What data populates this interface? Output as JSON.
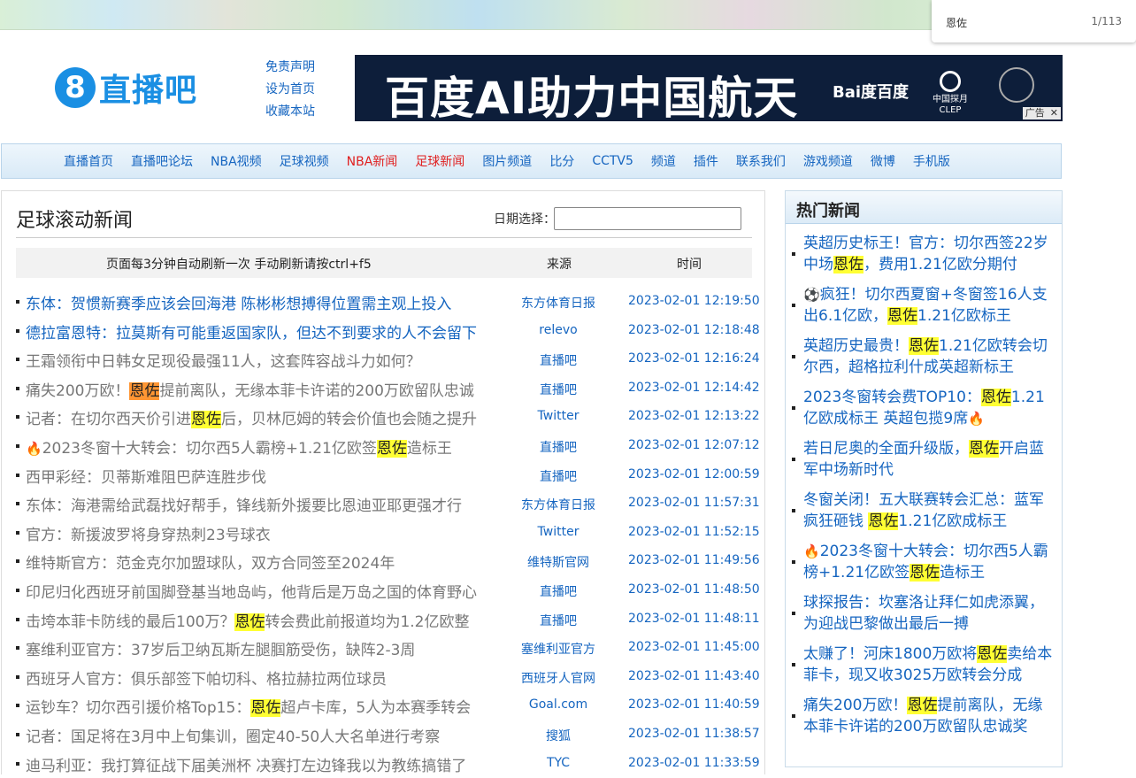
{
  "find": {
    "query": "恩佐",
    "count": "1/113"
  },
  "logo": {
    "number": "8",
    "text": "直播吧"
  },
  "toplinks": [
    "免责声明",
    "设为首页",
    "收藏本站"
  ],
  "banner": {
    "title": "百度AI助力中国航天",
    "brand": "Bai度百度",
    "partner": "中国探月",
    "partner_sub": "CLEP",
    "ad_label": "广告",
    "ad_close": "✕"
  },
  "nav": [
    {
      "label": "直播首页"
    },
    {
      "label": "直播吧论坛"
    },
    {
      "label": "NBA视频"
    },
    {
      "label": "足球视频"
    },
    {
      "label": "NBA新闻",
      "active": true
    },
    {
      "label": "足球新闻",
      "active": true
    },
    {
      "label": "图片频道"
    },
    {
      "label": "比分"
    },
    {
      "label": "CCTV5"
    },
    {
      "label": "频道"
    },
    {
      "label": "插件"
    },
    {
      "label": "联系我们"
    },
    {
      "label": "游戏频道"
    },
    {
      "label": "微博"
    },
    {
      "label": "手机版"
    }
  ],
  "main": {
    "title": "足球滚动新闻",
    "date_label": "日期选择：",
    "date_value": "",
    "headers": {
      "info": "页面每3分钟自动刷新一次 手动刷新请按ctrl+f5",
      "source": "来源",
      "time": "时间"
    },
    "rows": [
      {
        "title": "东体：贺惯新赛季应该会回海港 陈彬彬想搏得位置需主观上投入",
        "source": "东方体育日报",
        "time": "2023-02-01 12:19:50",
        "blue": true
      },
      {
        "title": "德拉富恩特：拉莫斯有可能重返国家队，但达不到要求的人不会留下",
        "source": "relevo",
        "time": "2023-02-01 12:18:48",
        "blue": true
      },
      {
        "title": "王霜领衔中日韩女足现役最强11人，这套阵容战斗力如何？",
        "source": "直播吧",
        "time": "2023-02-01 12:16:24"
      },
      {
        "pre": "痛失200万欧！",
        "hl": "恩佐",
        "hlclass": "hlo",
        "post": "提前离队，无缘本菲卡许诺的200万欧留队忠诚",
        "source": "直播吧",
        "time": "2023-02-01 12:14:42"
      },
      {
        "pre": "记者：在切尔西天价引进",
        "hl": "恩佐",
        "post": "后，贝林厄姆的转会价值也会随之提升",
        "source": "Twitter",
        "time": "2023-02-01 12:13:22"
      },
      {
        "icon": "🔥",
        "pre": "2023冬窗十大转会：切尔西5人霸榜+1.21亿欧签",
        "hl": "恩佐",
        "post": "造标王",
        "source": "直播吧",
        "time": "2023-02-01 12:07:12"
      },
      {
        "title": "西甲彩经：贝蒂斯难阻巴萨连胜步伐",
        "source": "直播吧",
        "time": "2023-02-01 12:00:59"
      },
      {
        "title": "东体：海港需给武磊找好帮手，锋线新外援要比恩迪亚耶更强才行",
        "source": "东方体育日报",
        "time": "2023-02-01 11:57:31"
      },
      {
        "title": "官方：新援波罗将身穿热刺23号球衣",
        "source": "Twitter",
        "time": "2023-02-01 11:52:15"
      },
      {
        "title": "维特斯官方：范金克尔加盟球队，双方合同签至2024年",
        "source": "维特斯官网",
        "time": "2023-02-01 11:49:56"
      },
      {
        "title": "印尼归化西班牙前国脚登基当地岛屿，他背后是万岛之国的体育野心",
        "source": "直播吧",
        "time": "2023-02-01 11:48:50"
      },
      {
        "pre": "击垮本菲卡防线的最后100万？",
        "hl": "恩佐",
        "post": "转会费此前报道均为1.2亿欧整",
        "source": "直播吧",
        "time": "2023-02-01 11:48:11"
      },
      {
        "title": "塞维利亚官方：37岁后卫纳瓦斯左腿腘筋受伤，缺阵2-3周",
        "source": "塞维利亚官方",
        "time": "2023-02-01 11:45:00"
      },
      {
        "title": "西班牙人官方：俱乐部签下帕切科、格拉赫拉两位球员",
        "source": "西班牙人官网",
        "time": "2023-02-01 11:43:40"
      },
      {
        "pre": "运钞车？切尔西引援价格Top15：",
        "hl": "恩佐",
        "post": "超卢卡库，5人为本赛季转会",
        "source": "Goal.com",
        "time": "2023-02-01 11:40:59"
      },
      {
        "title": "记者：国足将在3月中上旬集训，圈定40-50人大名单进行考察",
        "source": "搜狐",
        "time": "2023-02-01 11:38:57"
      },
      {
        "title": "迪马利亚：我打算征战下届美洲杯 决赛打左边锋我以为教练搞错了",
        "source": "TYC",
        "time": "2023-02-01 11:33:59"
      }
    ]
  },
  "side": {
    "title": "热门新闻",
    "items": [
      {
        "pre": "英超历史标王！官方：切尔西签22岁中场",
        "hl": "恩佐",
        "post": "，费用1.21亿欧分期付"
      },
      {
        "icon": "⚽",
        "pre": "疯狂！切尔西夏窗+冬窗签16人支出6.1亿欧，",
        "hl": "恩佐",
        "post": "1.21亿欧标王"
      },
      {
        "pre": "英超历史最贵！",
        "hl": "恩佐",
        "post": "1.21亿欧转会切尔西，超格拉利什成英超新标王"
      },
      {
        "pre": "2023冬窗转会费TOP10：",
        "hl": "恩佐",
        "post": "1.21亿欧成标王 英超包揽9席",
        "icon_end": "🔥"
      },
      {
        "pre": "若日尼奥的全面升级版，",
        "hl": "恩佐",
        "post": "开启蓝军中场新时代"
      },
      {
        "pre": "冬窗关闭！五大联赛转会汇总：蓝军疯狂砸钱 ",
        "hl": "恩佐",
        "post": "1.21亿欧成标王"
      },
      {
        "icon": "🔥",
        "pre": "2023冬窗十大转会：切尔西5人霸榜+1.21亿欧签",
        "hl": "恩佐",
        "post": "造标王"
      },
      {
        "pre": "球探报告：坎塞洛让拜仁如虎添翼，为迎战巴黎做出最后一搏"
      },
      {
        "pre": "太赚了！河床1800万欧将",
        "hl": "恩佐",
        "post": "卖给本菲卡，现又收3025万欧转会分成"
      },
      {
        "pre": "痛失200万欧！",
        "hl": "恩佐",
        "post": "提前离队，无缘本菲卡许诺的200万欧留队忠诚奖"
      }
    ]
  }
}
